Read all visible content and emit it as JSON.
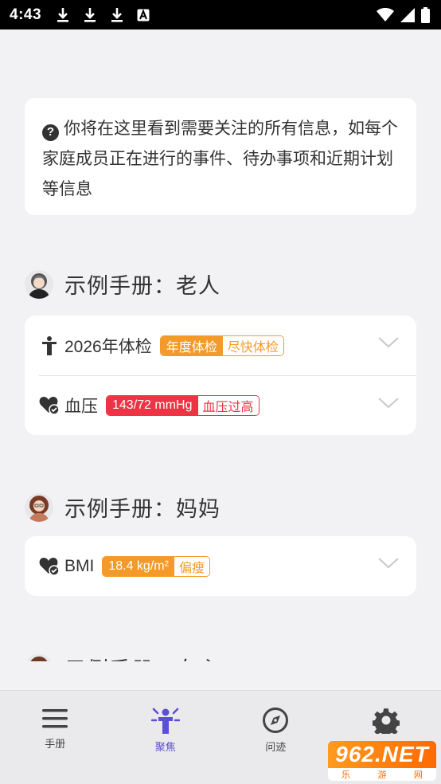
{
  "status_bar": {
    "time": "4:43",
    "icons": [
      "download-icon",
      "download-icon",
      "download-icon",
      "a-notification-icon"
    ],
    "right_icons": [
      "wifi-icon",
      "signal-icon",
      "battery-icon"
    ]
  },
  "info": {
    "text": "你将在这里看到需要关注的所有信息，如每个家庭成员正在进行的事件、待办事项和近期计划等信息"
  },
  "sections": [
    {
      "title": "示例手册：老人",
      "rows": [
        {
          "label": "2026年体检",
          "tag_main": "年度体检",
          "tag_sub": "尽快体检",
          "tag_color": "orange"
        },
        {
          "label": "血压",
          "tag_main": "143/72 mmHg",
          "tag_sub": "血压过高",
          "tag_color": "red"
        }
      ]
    },
    {
      "title": "示例手册：妈妈",
      "rows": [
        {
          "label": "BMI",
          "tag_main": "18.4 kg/m²",
          "tag_sub": "偏瘦",
          "tag_color": "orange"
        }
      ]
    },
    {
      "title": "示例手册：女主"
    }
  ],
  "nav": {
    "items": [
      {
        "label": "手册",
        "icon": "menu-icon"
      },
      {
        "label": "聚焦",
        "icon": "person-focus-icon",
        "active": true
      },
      {
        "label": "问迹",
        "icon": "compass-icon"
      },
      {
        "label": "设置",
        "icon": "gear-icon"
      }
    ]
  },
  "watermark": {
    "brand": "962.NET",
    "sub": [
      "乐",
      "游",
      "网"
    ]
  },
  "colors": {
    "accent": "#5b4fd6",
    "orange": "#f39a2a",
    "red": "#ee3344"
  }
}
